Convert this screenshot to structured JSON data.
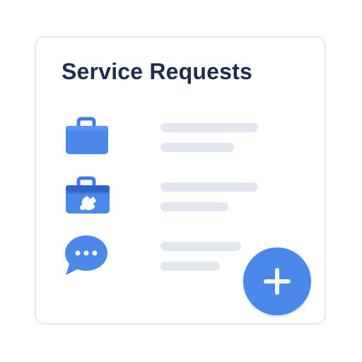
{
  "card": {
    "title": "Service Requests"
  },
  "requests": [
    {
      "icon": "briefcase-icon"
    },
    {
      "icon": "toolbox-wrench-icon"
    },
    {
      "icon": "chat-bubble-icon"
    }
  ],
  "add_button": {
    "icon": "plus-icon"
  },
  "colors": {
    "accent": "#4a88ea",
    "accent_dark": "#2f63c9",
    "title": "#1f2d4d",
    "placeholder_bar": "#e2e7ee",
    "card_border": "#e3e8ee"
  }
}
